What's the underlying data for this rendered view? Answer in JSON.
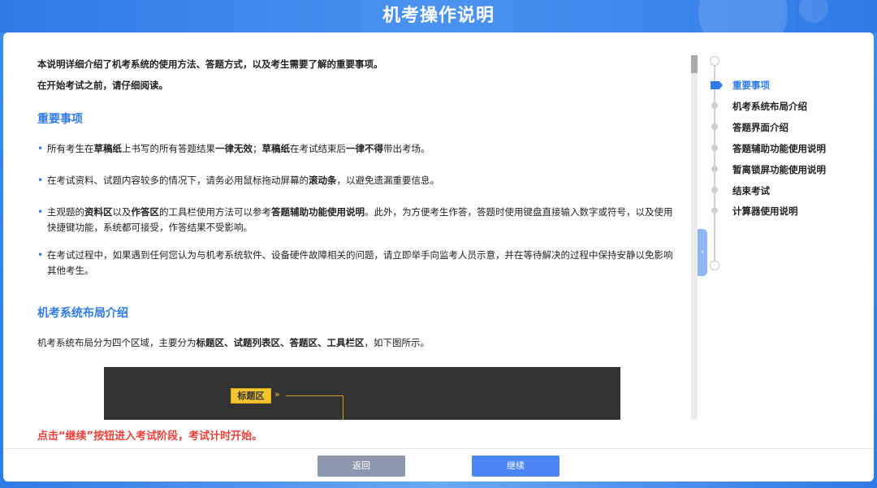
{
  "header": {
    "title": "机考操作说明"
  },
  "intro": {
    "line1": "本说明详细介绍了机考系统的使用方法、答题方式，以及考生需要了解的重要事项。",
    "line2": "在开始考试之前，请仔细阅读。"
  },
  "sections": {
    "important": {
      "title": "重要事项",
      "bullets": [
        [
          {
            "t": "所有考生在",
            "b": false
          },
          {
            "t": "草稿纸",
            "b": true
          },
          {
            "t": "上书写的所有答题结果",
            "b": false
          },
          {
            "t": "一律无效",
            "b": true
          },
          {
            "t": "；",
            "b": false
          },
          {
            "t": "草稿纸",
            "b": true
          },
          {
            "t": "在考试结束后",
            "b": false
          },
          {
            "t": "一律不得",
            "b": true
          },
          {
            "t": "带出考场。",
            "b": false
          }
        ],
        [
          {
            "t": "在考试资料、试题内容较多的情况下，请务必用鼠标拖动屏幕的",
            "b": false
          },
          {
            "t": "滚动条",
            "b": true
          },
          {
            "t": "，以避免遗漏重要信息。",
            "b": false
          }
        ],
        [
          {
            "t": "主观题的",
            "b": false
          },
          {
            "t": "资料区",
            "b": true
          },
          {
            "t": "以及",
            "b": false
          },
          {
            "t": "作答区",
            "b": true
          },
          {
            "t": "的工具栏使用方法可以参考",
            "b": false
          },
          {
            "t": "答题辅助功能使用说明",
            "b": true
          },
          {
            "t": "。此外，为方便考生作答，答题时使用键盘直接输入数字或符号，以及使用快捷键功能，系统都可接受，作答结果不受影响。",
            "b": false
          }
        ],
        [
          {
            "t": "在考试过程中，如果遇到任何您认为与机考系统软件、设备硬件故障相关的问题，请立即举手向监考人员示意，并在等待解决的过程中保持安静以免影响其他考生。",
            "b": false
          }
        ]
      ]
    },
    "layout": {
      "title": "机考系统布局介绍",
      "paragraph": [
        {
          "t": "机考系统布局分为四个区域，主要分为",
          "b": false
        },
        {
          "t": "标题区、试题列表区、答题区、工具栏区",
          "b": true
        },
        {
          "t": "，如下图所示。",
          "b": false
        }
      ],
      "diagram": {
        "tag_label": "标题区",
        "arrow": "»"
      }
    }
  },
  "toc": {
    "items": [
      {
        "label": "重要事项",
        "active": true
      },
      {
        "label": "机考系统布局介绍",
        "active": false
      },
      {
        "label": "答题界面介绍",
        "active": false
      },
      {
        "label": "答题辅助功能使用说明",
        "active": false
      },
      {
        "label": "暂离锁屏功能使用说明",
        "active": false
      },
      {
        "label": "结束考试",
        "active": false
      },
      {
        "label": "计算器使用说明",
        "active": false
      }
    ],
    "collapse_icon": "chevron-right-icon"
  },
  "notice": "点击“继续”按钮进入考试阶段，考试计时开始。",
  "buttons": {
    "back": "返回",
    "continue": "继续"
  },
  "colors": {
    "accent": "#2f7be8",
    "notice": "#e8413a",
    "back_button": "#8c98ad",
    "continue_button": "#4d86f4"
  }
}
